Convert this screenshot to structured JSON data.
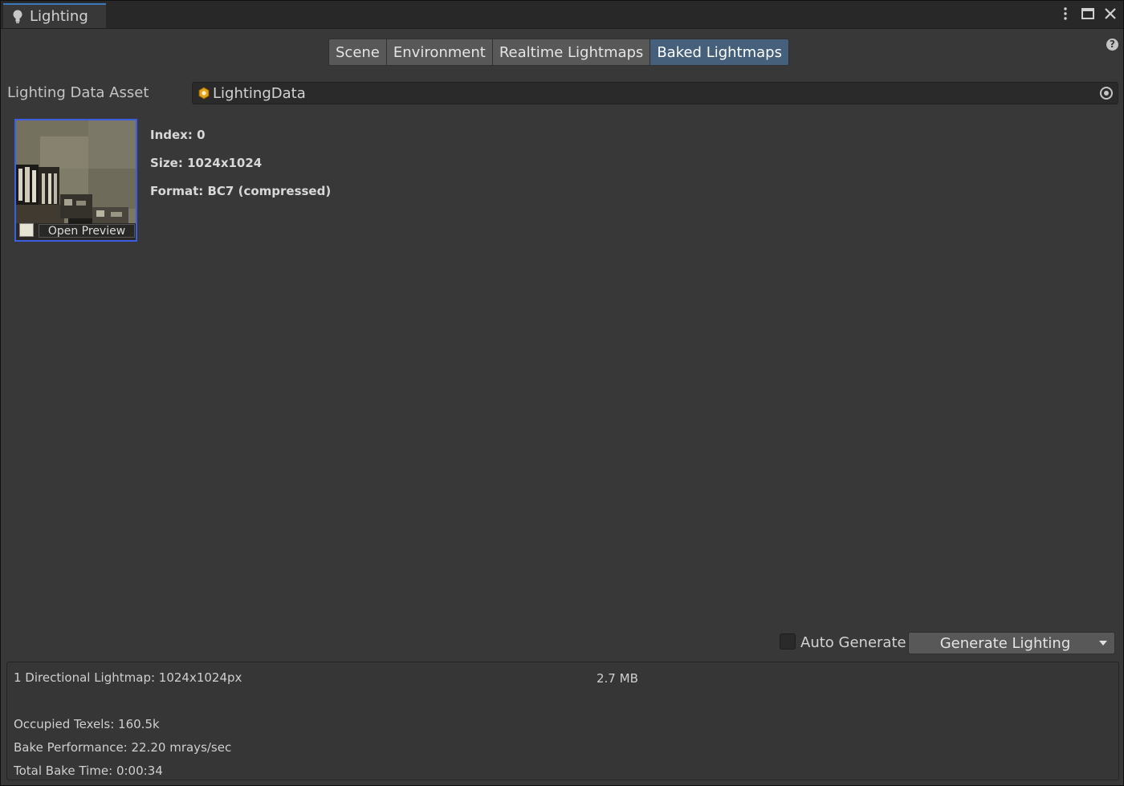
{
  "window": {
    "title": "Lighting"
  },
  "toolbar": {
    "tabs": [
      {
        "label": "Scene",
        "active": false
      },
      {
        "label": "Environment",
        "active": false
      },
      {
        "label": "Realtime Lightmaps",
        "active": false
      },
      {
        "label": "Baked Lightmaps",
        "active": true
      }
    ]
  },
  "lighting_data": {
    "label": "Lighting Data Asset",
    "value": "LightingData"
  },
  "lightmap": {
    "open_preview": "Open Preview",
    "index": "Index: 0",
    "size": "Size: 1024x1024",
    "format": "Format: BC7 (compressed)"
  },
  "actions": {
    "auto_generate_label": "Auto Generate",
    "auto_generate_checked": false,
    "generate_label": "Generate Lighting"
  },
  "stats": {
    "lightmaps": "1 Directional Lightmap: 1024x1024px",
    "memory": "2.7 MB",
    "occupied_texels": "Occupied Texels: 160.5k",
    "bake_performance": "Bake Performance: 22.20 mrays/sec",
    "total_bake_time": "Total Bake Time: 0:00:34"
  },
  "colors": {
    "panel_bg": "#383838",
    "active_tab": "#46607c",
    "selection_border": "#3c5ee0"
  },
  "icons": [
    "lightbulb-icon",
    "more-options-icon",
    "maximize-icon",
    "close-icon",
    "help-icon",
    "lighting-data-asset-icon",
    "object-picker-icon",
    "dropdown-arrow-icon"
  ]
}
